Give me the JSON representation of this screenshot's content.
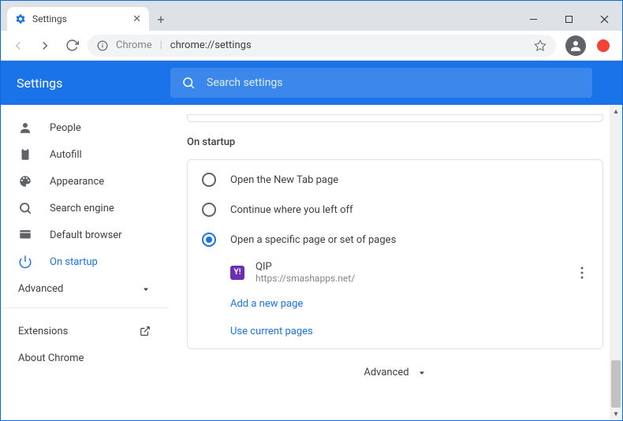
{
  "tab": {
    "title": "Settings"
  },
  "omnibox": {
    "prefix": "Chrome",
    "url": "chrome://settings"
  },
  "header": {
    "title": "Settings"
  },
  "search": {
    "placeholder": "Search settings"
  },
  "sidebar": {
    "items": [
      {
        "label": "People"
      },
      {
        "label": "Autofill"
      },
      {
        "label": "Appearance"
      },
      {
        "label": "Search engine"
      },
      {
        "label": "Default browser"
      },
      {
        "label": "On startup"
      }
    ],
    "advanced": "Advanced",
    "extensions": "Extensions",
    "about": "About Chrome"
  },
  "main": {
    "section_title": "On startup",
    "radios": [
      {
        "label": "Open the New Tab page"
      },
      {
        "label": "Continue where you left off"
      },
      {
        "label": "Open a specific page or set of pages"
      }
    ],
    "page": {
      "name": "QIP",
      "url": "https://smashapps.net/"
    },
    "add_page": "Add a new page",
    "use_current": "Use current pages",
    "advanced": "Advanced"
  }
}
